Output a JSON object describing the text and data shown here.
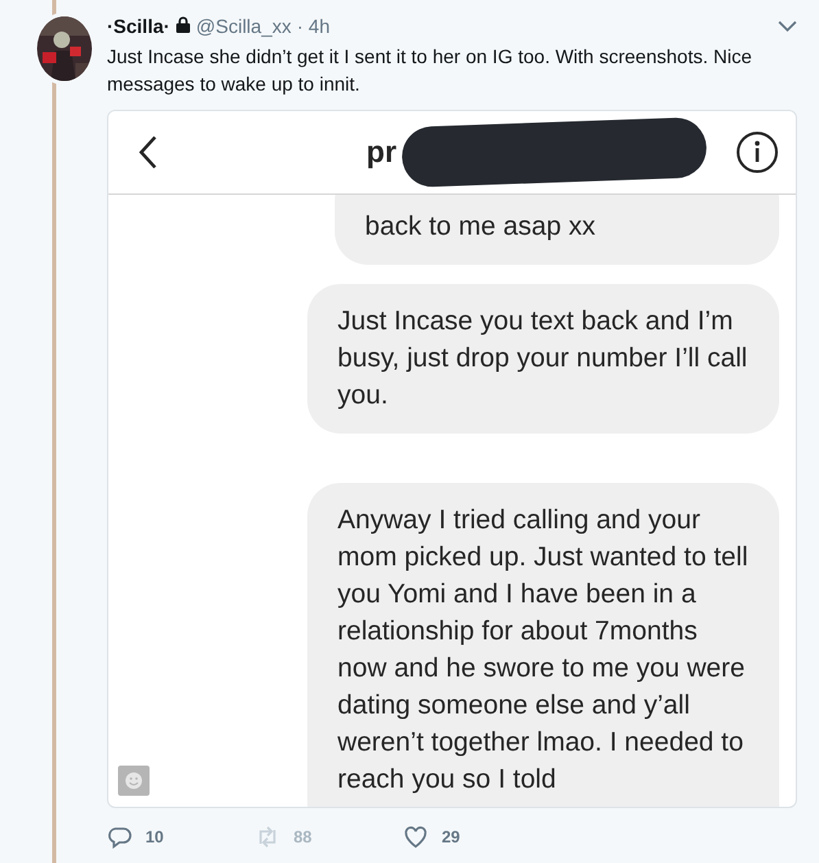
{
  "tweet": {
    "display_name": "·Scilla·",
    "protected": true,
    "handle": "@Scilla_xx",
    "time": "· 4h",
    "text": "Just Incase she didn’t get it I sent it to her on IG too. With screenshots. Nice messages to wake up to innit.",
    "attachment": {
      "header": {
        "name": "pr",
        "redacted": true
      },
      "messages": [
        {
          "text": "back to me asap xx"
        },
        {
          "text": "Just Incase you text back and I’m busy, just drop your number I’ll call you."
        },
        {
          "text": "Anyway I tried calling and your mom picked up. Just wanted to tell you Yomi and I have been in a relationship for about 7months now and he swore to me you were dating someone else and y’all weren’t together lmao. I needed to reach you so I told"
        }
      ]
    },
    "actions": [
      {
        "kind": "reply",
        "count": "10",
        "disabled": false
      },
      {
        "kind": "retweet",
        "count": "88",
        "disabled": true
      },
      {
        "kind": "like",
        "count": "29",
        "disabled": false
      }
    ]
  }
}
